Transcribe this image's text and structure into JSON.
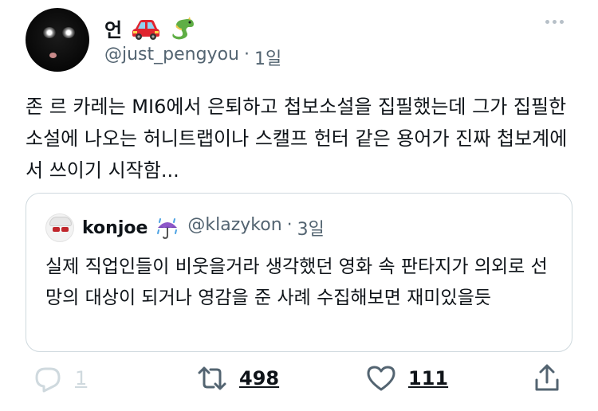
{
  "tweet": {
    "author": {
      "display_name": "언",
      "name_emojis": [
        "car-emoji",
        "dragon-emoji"
      ],
      "handle": "@just_pengyou",
      "separator": "·",
      "time": "1일"
    },
    "text": "존 르 카레는 MI6에서 은퇴하고 첩보소설을 집필했는데 그가 집필한 소설에 나오는 허니트랩이나 스캘프 헌터 같은 용어가 진짜 첩보계에서 쓰이기 시작함...",
    "quote": {
      "display_name": "konjoe",
      "name_emoji": "umbrella-rain-emoji",
      "handle": "@klazykon",
      "separator": "·",
      "time": "3일",
      "text": "실제 직업인들이 비웃을거라 생각했던 영화 속 판타지가 의외로 선망의 대상이 되거나 영감을 준 사례 수집해보면 재미있을듯"
    },
    "actions": {
      "reply_count": "1",
      "retweet_count": "498",
      "like_count": "111"
    }
  },
  "colors": {
    "text": "#0f1419",
    "secondary": "#536471",
    "border": "#cfd9de",
    "icon": "#536471"
  }
}
